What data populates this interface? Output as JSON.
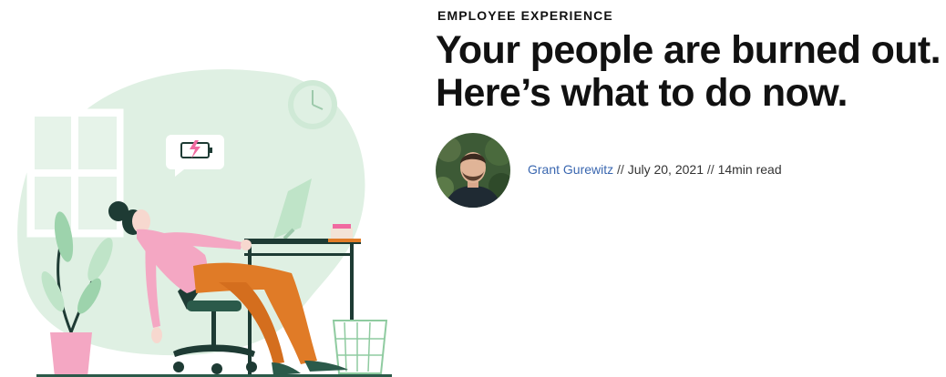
{
  "article": {
    "category": "EMPLOYEE EXPERIENCE",
    "title_line1": "Your people are burned out.",
    "title_line2": "Here’s what to do now.",
    "author": "Grant Gurewitz",
    "separator": "//",
    "date": "July 20, 2021",
    "read_time": "14min read"
  },
  "illustration": {
    "icons": [
      "window",
      "wall-clock-icon",
      "low-battery-icon",
      "desk",
      "computer-monitor",
      "office-chair",
      "potted-plant",
      "wastebasket",
      "tired-woman"
    ]
  },
  "colors": {
    "title": "#111111",
    "author_link": "#3a67b0",
    "illustration_mint": "#dff0e3",
    "illustration_pink": "#f4a7c3",
    "illustration_orange": "#e07b27",
    "illustration_dark_green": "#1e3b34"
  }
}
